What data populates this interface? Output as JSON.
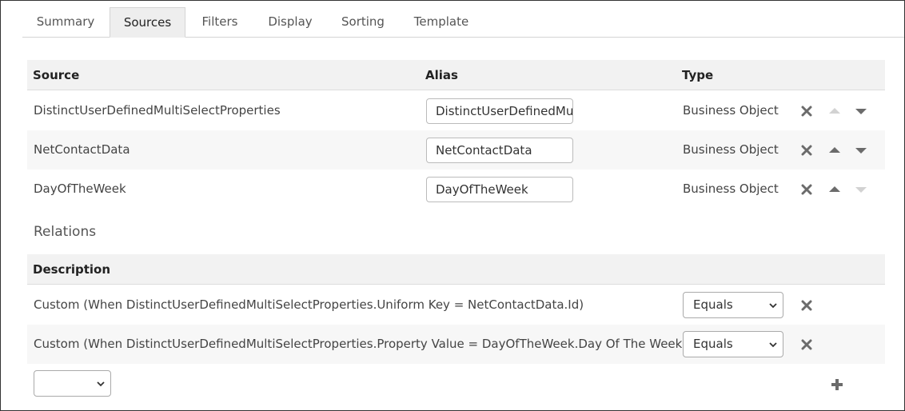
{
  "tabs": [
    {
      "label": "Summary"
    },
    {
      "label": "Sources"
    },
    {
      "label": "Filters"
    },
    {
      "label": "Display"
    },
    {
      "label": "Sorting"
    },
    {
      "label": "Template"
    }
  ],
  "active_tab": "Sources",
  "sources": {
    "headers": {
      "source": "Source",
      "alias": "Alias",
      "type": "Type"
    },
    "rows": [
      {
        "source": "DistinctUserDefinedMultiSelectProperties",
        "alias": "DistinctUserDefinedMu",
        "type": "Business Object",
        "can_move_up": false,
        "can_move_down": true
      },
      {
        "source": "NetContactData",
        "alias": "NetContactData",
        "type": "Business Object",
        "can_move_up": true,
        "can_move_down": true
      },
      {
        "source": "DayOfTheWeek",
        "alias": "DayOfTheWeek",
        "type": "Business Object",
        "can_move_up": true,
        "can_move_down": false
      }
    ]
  },
  "relations": {
    "title": "Relations",
    "header": "Description",
    "rows": [
      {
        "description": "Custom (When DistinctUserDefinedMultiSelectProperties.Uniform Key = NetContactData.Id)",
        "operator": "Equals"
      },
      {
        "description": "Custom (When DistinctUserDefinedMultiSelectProperties.Property Value = DayOfTheWeek.Day Of The Week Code)",
        "operator": "Equals"
      }
    ],
    "new_relation_select": ""
  },
  "icons": {
    "remove": "remove-icon",
    "move_up": "arrow-up-icon",
    "move_down": "arrow-down-icon",
    "add": "add-icon"
  },
  "colors": {
    "icon_active": "#6b6b6b",
    "icon_disabled": "#d2d2d2",
    "tab_active_bg": "#eeeeee",
    "header_bg": "#f2f2f2"
  }
}
